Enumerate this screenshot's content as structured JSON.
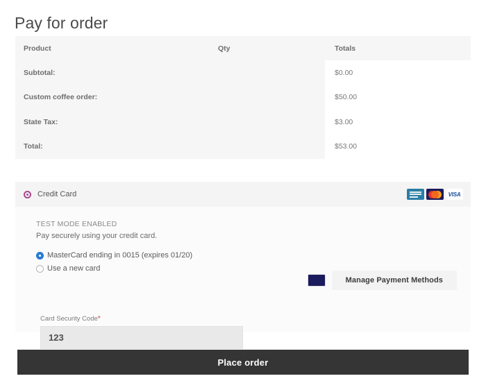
{
  "page": {
    "title": "Pay for order"
  },
  "order_table": {
    "columns": [
      "Product",
      "Qty",
      "Totals"
    ],
    "rows": [
      {
        "label": "Subtotal:",
        "qty": "",
        "total": "$0.00"
      },
      {
        "label": "Custom coffee order:",
        "qty": "",
        "total": "$50.00"
      },
      {
        "label": "State Tax:",
        "qty": "",
        "total": "$3.00"
      },
      {
        "label": "Total:",
        "qty": "",
        "total": "$53.00"
      }
    ]
  },
  "payment": {
    "method_title": "Credit Card",
    "card_logos": [
      "amex-logo",
      "mastercard-logo",
      "visa-logo"
    ],
    "visa_text": "VISA",
    "test_mode": "TEST MODE ENABLED",
    "description": "Pay securely using your credit card.",
    "saved_cards": [
      {
        "label": "MasterCard ending in 0015 (expires 01/20)",
        "selected": true
      },
      {
        "label": "Use a new card",
        "selected": false
      }
    ],
    "manage_button": "Manage Payment Methods",
    "csc": {
      "label": "Card Security Code",
      "required_marker": "*",
      "value": "123",
      "placeholder": ""
    }
  },
  "actions": {
    "place_order": "Place order"
  },
  "colors": {
    "accent_radio": "#a8478f",
    "selected_radio": "#2d7dd2",
    "button_dark": "#353535",
    "required_star": "#d83a3a",
    "table_bg": "#f6f6f6"
  }
}
